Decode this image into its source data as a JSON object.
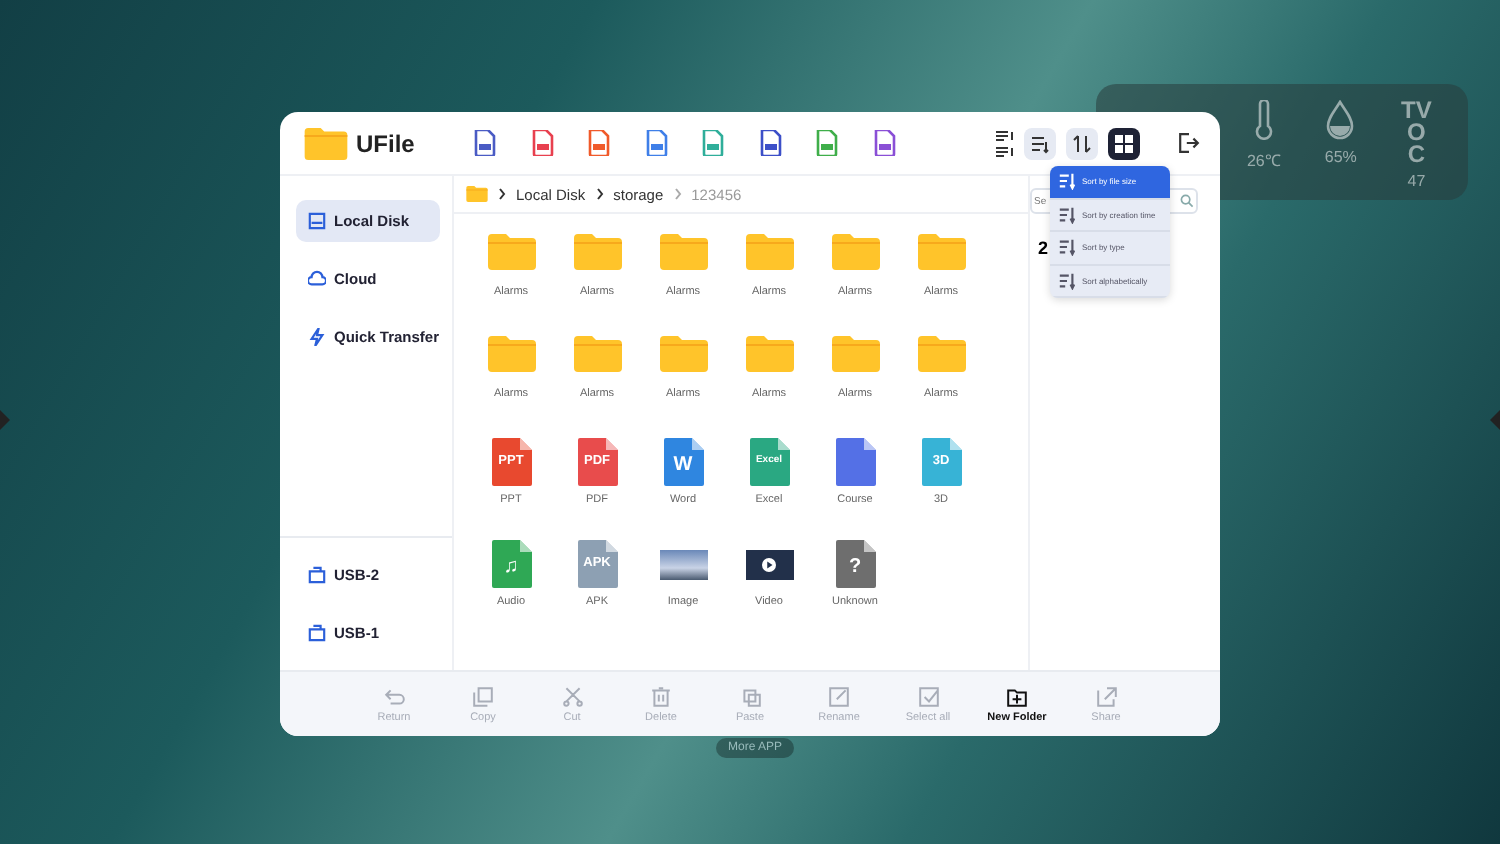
{
  "weather": [
    {
      "kind": "temperature",
      "value": "26℃"
    },
    {
      "kind": "humidity",
      "value": "65%"
    },
    {
      "kind": "tvoc",
      "label": "TVOC",
      "value": "47"
    }
  ],
  "more_app": "More APP",
  "app": {
    "title": "UFile"
  },
  "type_filters": [
    {
      "color": "#4a5bc4"
    },
    {
      "color": "#e8404f"
    },
    {
      "color": "#f05a2a"
    },
    {
      "color": "#3f7fe8"
    },
    {
      "color": "#2fae9a"
    },
    {
      "color": "#3c4fc8"
    },
    {
      "color": "#3fae4a"
    },
    {
      "color": "#8a4fd6"
    }
  ],
  "view_buttons": [
    {
      "kind": "sort",
      "selected": false
    },
    {
      "kind": "order",
      "selected": false
    },
    {
      "kind": "grid",
      "selected": true
    }
  ],
  "sidebar": {
    "items": [
      {
        "label": "Local Disk",
        "kind": "disk",
        "selected": true
      },
      {
        "label": "Cloud",
        "kind": "cloud",
        "selected": false
      },
      {
        "label": "Quick Transfer",
        "kind": "bolt",
        "selected": false
      }
    ],
    "usb": [
      {
        "label": "USB-2",
        "selected": false
      },
      {
        "label": "USB-1",
        "selected": false
      }
    ]
  },
  "breadcrumb": [
    {
      "label": "Local Disk",
      "current": false
    },
    {
      "label": "storage",
      "current": false
    },
    {
      "label": "123456",
      "current": true
    }
  ],
  "files": [
    {
      "name": "Alarms",
      "kind": "folder"
    },
    {
      "name": "Alarms",
      "kind": "folder"
    },
    {
      "name": "Alarms",
      "kind": "folder"
    },
    {
      "name": "Alarms",
      "kind": "folder"
    },
    {
      "name": "Alarms",
      "kind": "folder"
    },
    {
      "name": "Alarms",
      "kind": "folder"
    },
    {
      "name": "Alarms",
      "kind": "folder"
    },
    {
      "name": "Alarms",
      "kind": "folder"
    },
    {
      "name": "Alarms",
      "kind": "folder"
    },
    {
      "name": "Alarms",
      "kind": "folder"
    },
    {
      "name": "Alarms",
      "kind": "folder"
    },
    {
      "name": "Alarms",
      "kind": "folder"
    },
    {
      "name": "PPT",
      "kind": "doc",
      "badge": "PPT",
      "color": "#e8492f"
    },
    {
      "name": "PDF",
      "kind": "doc",
      "badge": "PDF",
      "color": "#e84c4c"
    },
    {
      "name": "Word",
      "kind": "doc",
      "badge": "W",
      "color": "#2f86e0"
    },
    {
      "name": "Excel",
      "kind": "doc",
      "badge": "Excel",
      "color": "#2aa882"
    },
    {
      "name": "Course",
      "kind": "doc",
      "color": "#5470e6"
    },
    {
      "name": "3D",
      "kind": "doc",
      "badge": "3D",
      "color": "#37b3d6"
    },
    {
      "name": "Audio",
      "kind": "doc",
      "badge": "♫",
      "color": "#2fa855"
    },
    {
      "name": "APK",
      "kind": "doc",
      "badge": "APK",
      "color": "#8da0b3"
    },
    {
      "name": "Image",
      "kind": "image"
    },
    {
      "name": "Video",
      "kind": "video"
    },
    {
      "name": "Unknown",
      "kind": "doc",
      "badge": "?",
      "color": "#6e6e6e"
    }
  ],
  "search": {
    "placeholder": "Se"
  },
  "side_count": "2",
  "sort_menu": [
    {
      "label": "Sort by file size",
      "selected": true
    },
    {
      "label": "Sort by creation time",
      "selected": false
    },
    {
      "label": "Sort by type",
      "selected": false
    },
    {
      "label": "Sort alphabetically",
      "selected": false
    }
  ],
  "toolbar": [
    {
      "label": "Return",
      "kind": "return",
      "disabled": true
    },
    {
      "label": "Copy",
      "kind": "copy",
      "disabled": true
    },
    {
      "label": "Cut",
      "kind": "cut",
      "disabled": true
    },
    {
      "label": "Delete",
      "kind": "delete",
      "disabled": true
    },
    {
      "label": "Paste",
      "kind": "paste",
      "disabled": true
    },
    {
      "label": "Rename",
      "kind": "rename",
      "disabled": true
    },
    {
      "label": "Select all",
      "kind": "select",
      "disabled": true
    },
    {
      "label": "New Folder",
      "kind": "newfolder",
      "disabled": false
    },
    {
      "label": "Share",
      "kind": "share",
      "disabled": true
    }
  ]
}
